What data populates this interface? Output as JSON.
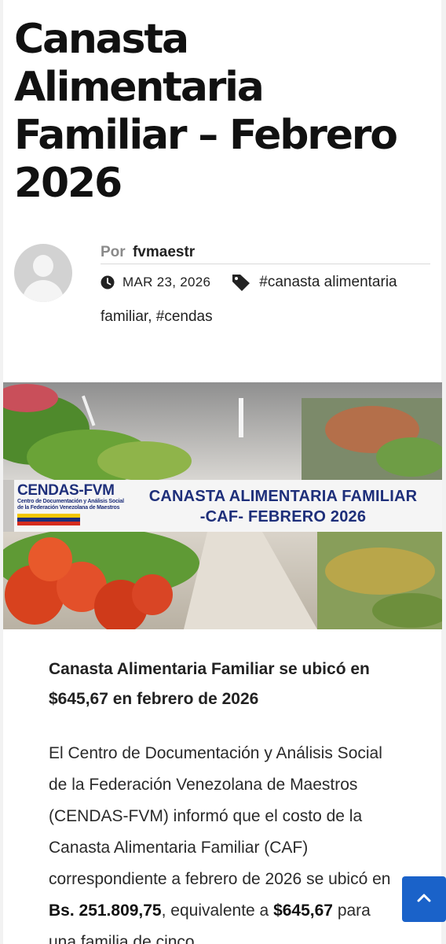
{
  "post": {
    "title": "Canasta Alimentaria Familiar – Febrero 2026",
    "author_prefix": "Por",
    "author": "fvmaestr",
    "date": "MAR 23, 2026",
    "tag_1": "#canasta alimentaria",
    "tag_1b": "familiar",
    "tag_sep": ", ",
    "tag_2": "#cendas"
  },
  "banner": {
    "logo_name": "CENDAS-FVM",
    "logo_sub_1": "Centro de Documentación y Análisis Social",
    "logo_sub_2": "de la Federación Venezolana de Maestros",
    "title_line_1": "CANASTA ALIMENTARIA FAMILIAR",
    "title_line_2": "-CAF-  FEBRERO 2026",
    "flag_colors": [
      "#f3c700",
      "#1e2f7a",
      "#d52b1e"
    ]
  },
  "article": {
    "headline": "Canasta Alimentaria Familiar se ubicó en $645,67 en febrero de 2026",
    "p1_a": "El Centro de Documentación y Análisis Social de la Federación Venezolana de Maestros (CENDAS-FVM) informó que el costo de la Canasta Alimentaria Familiar (CAF) correspondiente a febrero de 2026 se ubicó en ",
    "p1_b": "Bs. 251.809,75",
    "p1_c": ", equivalente a ",
    "p1_d": "$645,67",
    "p1_e": " para una familia de cinco"
  },
  "colors": {
    "accent": "#1a62c9",
    "logo_blue": "#1e2f7a"
  }
}
